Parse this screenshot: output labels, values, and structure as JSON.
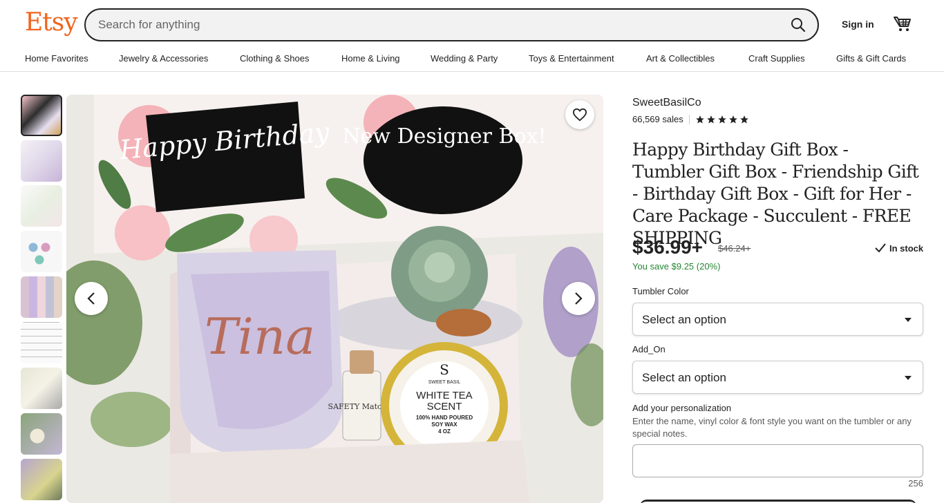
{
  "header": {
    "logo": "Etsy",
    "search_placeholder": "Search for anything",
    "sign_in": "Sign in",
    "icons": {
      "search": "search-icon",
      "cart": "cart-icon"
    },
    "brand_color": "#F1641E"
  },
  "nav": {
    "items": [
      "Home Favorites",
      "Jewelry & Accessories",
      "Clothing & Shoes",
      "Home & Living",
      "Wedding & Party",
      "Toys & Entertainment",
      "Art & Collectibles",
      "Craft Supplies",
      "Gifts & Gift Cards"
    ]
  },
  "gallery": {
    "thumbnail_count": 9,
    "active_thumbnail": 1,
    "main_image": {
      "card_text": "Happy Birthday",
      "badge_text": "New Designer Box!",
      "tumbler_name": "Tina",
      "matches_label": "SAFETY Matches",
      "candle_brand": "SWEET BASIL",
      "candle_line1": "WHITE TEA",
      "candle_line2": "SCENT",
      "candle_line3": "100% HAND POURED",
      "candle_line4": "SOY WAX",
      "candle_line5": "4 OZ"
    },
    "icons": {
      "favorite": "heart-icon",
      "prev": "chevron-left-icon",
      "next": "chevron-right-icon"
    }
  },
  "listing": {
    "shop_name": "SweetBasilCo",
    "sales": "66,569 sales",
    "rating_stars": 5,
    "title": "Happy Birthday Gift Box - Tumbler Gift Box - Friendship Gift - Birthday Gift Box - Gift for Her - Care Package - Succulent - FREE SHIPPING",
    "price": "$36.99+",
    "original_price": "$46.24+",
    "stock": "In stock",
    "savings": "You save $9.25 (20%)",
    "savings_color": "#258635",
    "options": [
      {
        "label": "Tumbler Color",
        "value": "Select an option"
      },
      {
        "label": "Add_On",
        "value": "Select an option"
      }
    ],
    "personalization": {
      "label": "Add your personalization",
      "hint": "Enter the name, vinyl color & font style you want on the tumbler or any special notes.",
      "counter": "256"
    }
  }
}
